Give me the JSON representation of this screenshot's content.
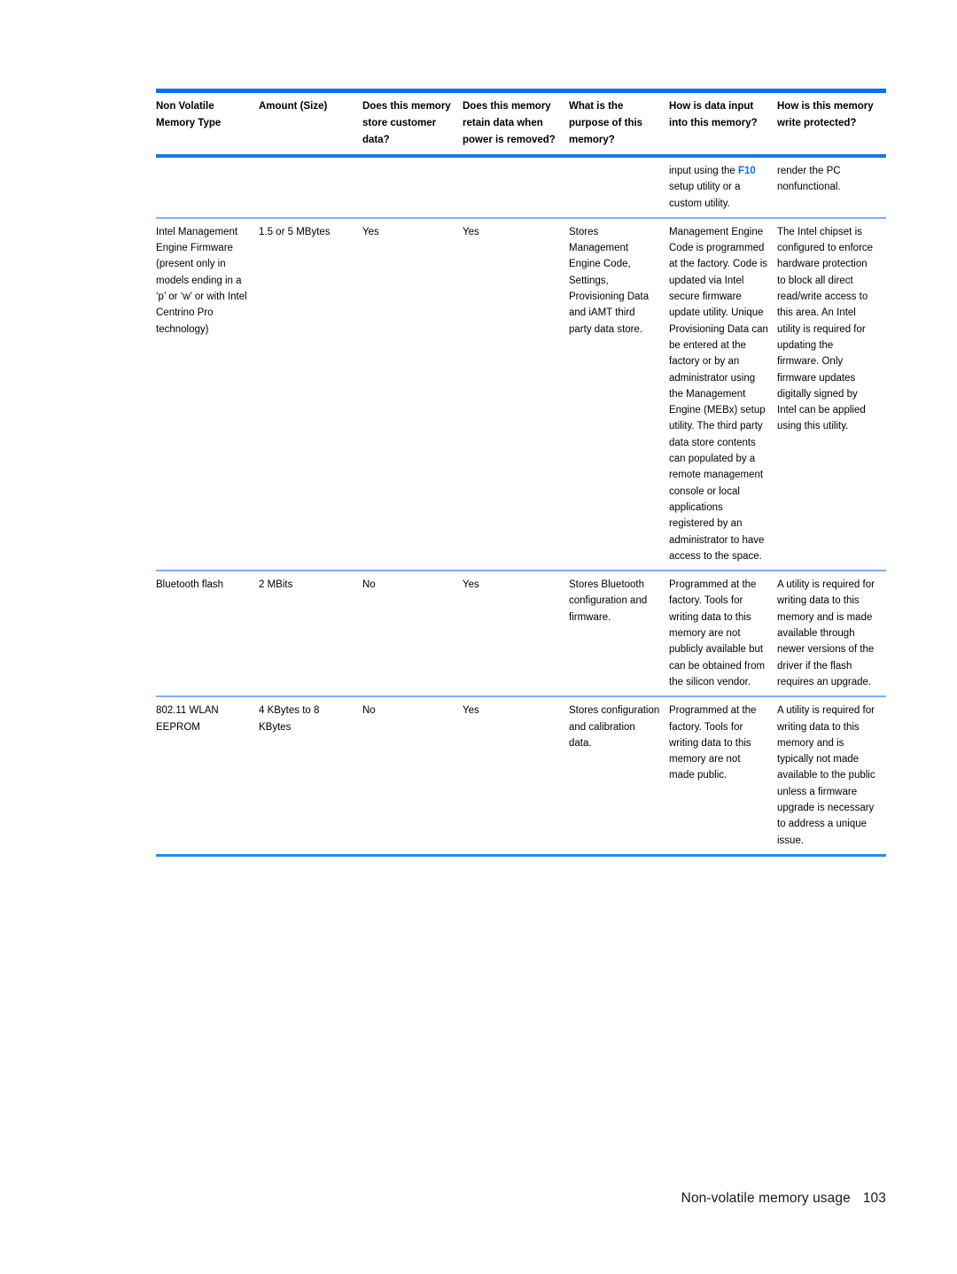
{
  "document": {
    "footer_title": "Non-volatile memory usage",
    "page_number": "103"
  },
  "colors": {
    "rule_primary": "#0a6efc",
    "rule_header_bottom": "#1878e8",
    "rule_row": "#7eaefc",
    "rule_bottom": "#2b8ae8",
    "kbd_reference": "#0a6efc"
  },
  "table": {
    "headers": [
      "Non Volatile Memory Type",
      "Amount (Size)",
      "Does this memory store customer data?",
      "Does this memory retain data when power is removed?",
      "What is the purpose of this memory?",
      "How is data input into this memory?",
      "How is this memory write protected?"
    ],
    "rows": [
      {
        "name": "",
        "amount": "",
        "stores_customer_data": "",
        "retains_data": "",
        "purpose": "",
        "input_prefix": "input using the ",
        "input_kbd": "F10",
        "input_suffix": " setup utility or a custom utility.",
        "write_protected": "render the PC nonfunctional."
      },
      {
        "name": "Intel Management Engine Firmware (present only in models ending in a ‘p’ or ‘w’ or with Intel Centrino Pro technology)",
        "amount": "1.5 or 5 MBytes",
        "stores_customer_data": "Yes",
        "retains_data": "Yes",
        "purpose": "Stores Management Engine Code, Settings, Provisioning Data and iAMT third party data store.",
        "input": "Management Engine Code is programmed at the factory. Code is updated via Intel secure firmware update utility. Unique Provisioning Data can be entered at the factory or by an administrator using the Management Engine (MEBx) setup utility. The third party data store contents can populated by a remote management console or local applications registered by an administrator to have access to the space.",
        "write_protected": "The Intel chipset is configured to enforce hardware protection to block all direct read/write access to this area. An Intel utility is required for updating the firmware. Only firmware updates digitally signed by Intel can be applied using this utility."
      },
      {
        "name": "Bluetooth flash",
        "amount": "2 MBits",
        "stores_customer_data": "No",
        "retains_data": "Yes",
        "purpose": "Stores Bluetooth configuration and firmware.",
        "input": "Programmed at the factory. Tools for writing data to this memory are not publicly available but can be obtained from the silicon vendor.",
        "write_protected": "A utility is required for writing data to this memory and is made available through newer versions of the driver if the flash requires an upgrade."
      },
      {
        "name": "802.11 WLAN EEPROM",
        "amount": "4 KBytes to 8 KBytes",
        "stores_customer_data": "No",
        "retains_data": "Yes",
        "purpose": "Stores configuration and calibration data.",
        "input": "Programmed at the factory. Tools for writing data to this memory are not made public.",
        "write_protected": "A utility is required for writing data to this memory and is typically not made available to the public unless a firmware upgrade is necessary to address a unique issue."
      }
    ]
  }
}
